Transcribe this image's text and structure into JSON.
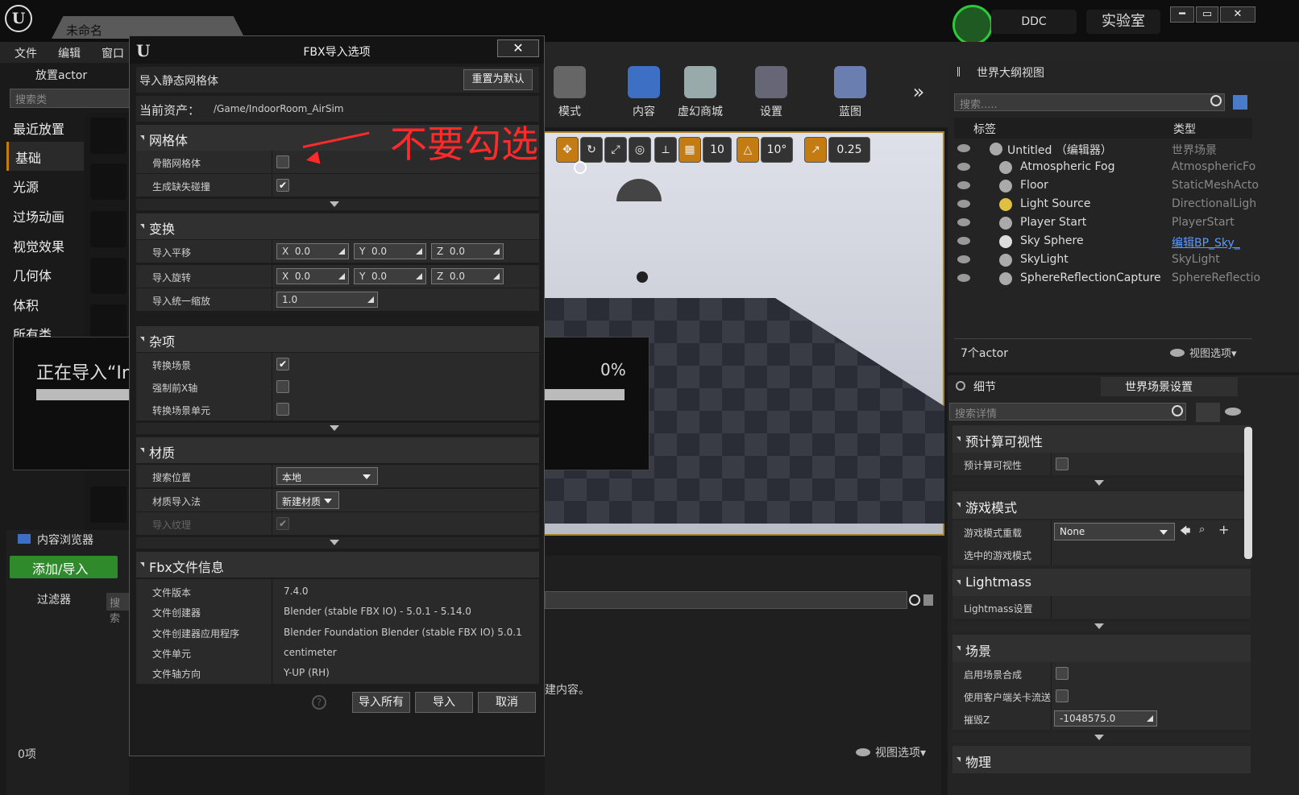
{
  "app": {
    "doc_tab": "未命名",
    "ddc": "DDC",
    "lab": "实验室",
    "menu": [
      "文件",
      "编辑",
      "窗口"
    ],
    "min": "━",
    "max": "▭",
    "close": "✕"
  },
  "left": {
    "tab": "放置actor",
    "search_placeholder": "搜索类",
    "categories": [
      "最近放置",
      "基础",
      "光源",
      "过场动画",
      "视觉效果",
      "几何体",
      "体积",
      "所有类"
    ]
  },
  "progress": {
    "text": "正在导入“In",
    "percent": "0%"
  },
  "toolbar": {
    "items": [
      "模式",
      "内容",
      "虚幻商城",
      "设置",
      "蓝图"
    ],
    "more": "»"
  },
  "viewport_bar": {
    "grid": "10",
    "angle": "10°",
    "scale": "0.25"
  },
  "content_browser": {
    "tab": "内容浏览器",
    "add_import": "添加/导入",
    "filters": "过滤器",
    "search_placeholder": "搜索",
    "count": "0项",
    "hint": "建内容。",
    "view_options": "视图选项"
  },
  "dialog": {
    "title": "FBX导入选项",
    "subtitle": "导入静态网格体",
    "reset": "重置为默认",
    "asset_label": "当前资产：",
    "asset_path": "/Game/IndoorRoom_AirSim",
    "mesh": {
      "title": "网格体",
      "skeletal": "骨骼网格体",
      "collision": "生成缺失碰撞"
    },
    "transform": {
      "title": "变换",
      "translation": "导入平移",
      "rotation": "导入旋转",
      "scale": "导入统一缩放",
      "x": "X",
      "y": "Y",
      "z": "Z",
      "v": "0.0",
      "scale_val": "1.0"
    },
    "misc": {
      "title": "杂项",
      "convert_scene": "转换场景",
      "force_x": "强制前X轴",
      "convert_unit": "转换场景单元"
    },
    "material": {
      "title": "材质",
      "search_loc": "搜索位置",
      "search_loc_val": "本地",
      "import_method": "材质导入法",
      "import_method_val": "新建材质",
      "import_tex": "导入纹理"
    },
    "fbx_info": {
      "title": "Fbx文件信息",
      "rows": [
        {
          "k": "文件版本",
          "v": "7.4.0"
        },
        {
          "k": "文件创建器",
          "v": "Blender (stable FBX IO) - 5.0.1 - 5.14.0"
        },
        {
          "k": "文件创建器应用程序",
          "v": "Blender Foundation Blender (stable FBX IO) 5.0.1"
        },
        {
          "k": "文件单元",
          "v": "centimeter"
        },
        {
          "k": "文件轴方向",
          "v": "Y-UP (RH)"
        }
      ]
    },
    "buttons": {
      "import_all": "导入所有",
      "import": "导入",
      "cancel": "取消"
    },
    "check": "✔"
  },
  "annotation": {
    "text": "不要勾选",
    "color": "#ff2a2a"
  },
  "outliner": {
    "tab": "世界大纲视图",
    "search_placeholder": "搜索.....",
    "col_label": "标签",
    "col_type": "类型",
    "rows": [
      {
        "name": "Untitled （编辑器）",
        "type": "世界场景"
      },
      {
        "name": "Atmospheric Fog",
        "type": "AtmosphericFo"
      },
      {
        "name": "Floor",
        "type": "StaticMeshActo"
      },
      {
        "name": "Light Source",
        "type": "DirectionalLigh"
      },
      {
        "name": "Player Start",
        "type": "PlayerStart"
      },
      {
        "name": "Sky Sphere",
        "type": "编辑BP_Sky_"
      },
      {
        "name": "SkyLight",
        "type": "SkyLight"
      },
      {
        "name": "SphereReflectionCapture",
        "type": "SphereReflectio"
      }
    ],
    "count": "7个actor",
    "view_options": "视图选项"
  },
  "details": {
    "tab_details": "细节",
    "tab_world": "世界场景设置",
    "search_placeholder": "搜索详情",
    "sections": {
      "precomp": "预计算可视性",
      "gamemode": "游戏模式",
      "lightmass": "Lightmass",
      "scene": "场景",
      "physics": "物理"
    },
    "precomp_row": "预计算可视性",
    "gm_override": "游戏模式重载",
    "gm_override_val": "None",
    "selected_gm": "选中的游戏模式",
    "lightmass_settings": "Lightmass设置",
    "enable_comp": "启用场景合成",
    "client_stream": "使用客户端关卡流送",
    "kill_z": "摧毁Z",
    "kill_z_val": "-1048575.0"
  }
}
